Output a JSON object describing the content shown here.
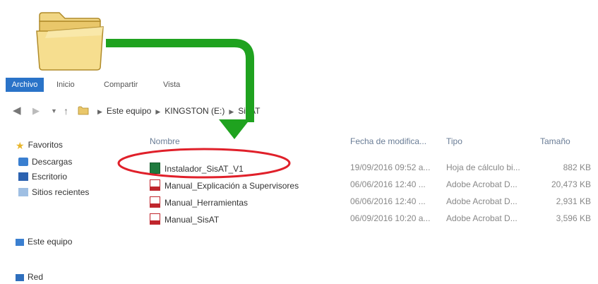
{
  "ribbon": {
    "tabs": [
      "Archivo",
      "Inicio",
      "Compartir",
      "Vista"
    ]
  },
  "address": {
    "crumbs": [
      "Este equipo",
      "KINGSTON (E:)",
      "SisAT"
    ]
  },
  "nav": {
    "favorites": "Favoritos",
    "items": [
      "Descargas",
      "Escritorio",
      "Sitios recientes"
    ],
    "this_pc": "Este equipo",
    "network": "Red"
  },
  "columns": {
    "name": "Nombre",
    "date": "Fecha de modifica...",
    "type": "Tipo",
    "size": "Tamaño"
  },
  "files": [
    {
      "name": "Instalador_SisAT_V1",
      "date": "19/09/2016 09:52 a...",
      "type": "Hoja de cálculo bi...",
      "size": "882 KB",
      "icon": "excel-icon"
    },
    {
      "name": "Manual_Explicación a Supervisores",
      "date": "06/06/2016 12:40 ...",
      "type": "Adobe Acrobat D...",
      "size": "20,473 KB",
      "icon": "pdf-icon"
    },
    {
      "name": "Manual_Herramientas",
      "date": "06/06/2016 12:40 ...",
      "type": "Adobe Acrobat D...",
      "size": "2,931 KB",
      "icon": "pdf-icon"
    },
    {
      "name": "Manual_SisAT",
      "date": "06/09/2016 10:20 a...",
      "type": "Adobe Acrobat D...",
      "size": "3,596 KB",
      "icon": "pdf-icon"
    }
  ],
  "colors": {
    "accent": "#2a73c8",
    "arrow": "#1fa21f",
    "highlight": "#e0202a"
  }
}
